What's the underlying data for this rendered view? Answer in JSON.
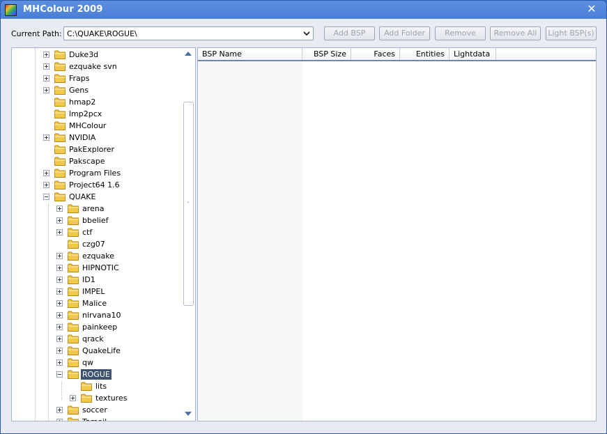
{
  "window": {
    "title": "MHColour 2009"
  },
  "toolbar": {
    "path_label": "Current Path:",
    "path_value": "C:\\QUAKE\\ROGUE\\",
    "buttons": [
      "Add BSP",
      "Add Folder",
      "Remove",
      "Remove All",
      "Light BSP(s)"
    ]
  },
  "tree": {
    "items": [
      {
        "label": "Duke3d",
        "level": 0,
        "expander": "plus"
      },
      {
        "label": "ezquake svn",
        "level": 0,
        "expander": "plus"
      },
      {
        "label": "Fraps",
        "level": 0,
        "expander": "plus"
      },
      {
        "label": "Gens",
        "level": 0,
        "expander": "plus"
      },
      {
        "label": "hmap2",
        "level": 0,
        "expander": "none"
      },
      {
        "label": "lmp2pcx",
        "level": 0,
        "expander": "none"
      },
      {
        "label": "MHColour",
        "level": 0,
        "expander": "none"
      },
      {
        "label": "NVIDIA",
        "level": 0,
        "expander": "plus"
      },
      {
        "label": "PakExplorer",
        "level": 0,
        "expander": "none"
      },
      {
        "label": "Pakscape",
        "level": 0,
        "expander": "none"
      },
      {
        "label": "Program Files",
        "level": 0,
        "expander": "plus"
      },
      {
        "label": "Project64 1.6",
        "level": 0,
        "expander": "plus"
      },
      {
        "label": "QUAKE",
        "level": 0,
        "expander": "minus",
        "open": true
      },
      {
        "label": "arena",
        "level": 1,
        "expander": "plus"
      },
      {
        "label": "bbelief",
        "level": 1,
        "expander": "plus"
      },
      {
        "label": "ctf",
        "level": 1,
        "expander": "plus"
      },
      {
        "label": "czg07",
        "level": 1,
        "expander": "none"
      },
      {
        "label": "ezquake",
        "level": 1,
        "expander": "plus"
      },
      {
        "label": "HIPNOTIC",
        "level": 1,
        "expander": "plus"
      },
      {
        "label": "ID1",
        "level": 1,
        "expander": "plus"
      },
      {
        "label": "IMPEL",
        "level": 1,
        "expander": "plus"
      },
      {
        "label": "Malice",
        "level": 1,
        "expander": "plus"
      },
      {
        "label": "nirvana10",
        "level": 1,
        "expander": "plus"
      },
      {
        "label": "painkeep",
        "level": 1,
        "expander": "plus"
      },
      {
        "label": "qrack",
        "level": 1,
        "expander": "plus"
      },
      {
        "label": "QuakeLife",
        "level": 1,
        "expander": "plus"
      },
      {
        "label": "qw",
        "level": 1,
        "expander": "plus"
      },
      {
        "label": "ROGUE",
        "level": 1,
        "expander": "minus",
        "open": true,
        "selected": true
      },
      {
        "label": "lits",
        "level": 2,
        "expander": "none"
      },
      {
        "label": "textures",
        "level": 2,
        "expander": "plus"
      },
      {
        "label": "soccer",
        "level": 1,
        "expander": "plus"
      },
      {
        "label": "Tamoil",
        "level": 1,
        "expander": "plus"
      }
    ]
  },
  "list": {
    "columns": [
      {
        "label": "BSP Name",
        "align": "left"
      },
      {
        "label": "BSP Size",
        "align": "right"
      },
      {
        "label": "Faces",
        "align": "right"
      },
      {
        "label": "Entities",
        "align": "right"
      },
      {
        "label": "Lightdata",
        "align": "left"
      }
    ]
  },
  "colors": {
    "titlebar": "#4a7fd6",
    "selection": "#3e5270",
    "folder": "#f2c94c"
  }
}
